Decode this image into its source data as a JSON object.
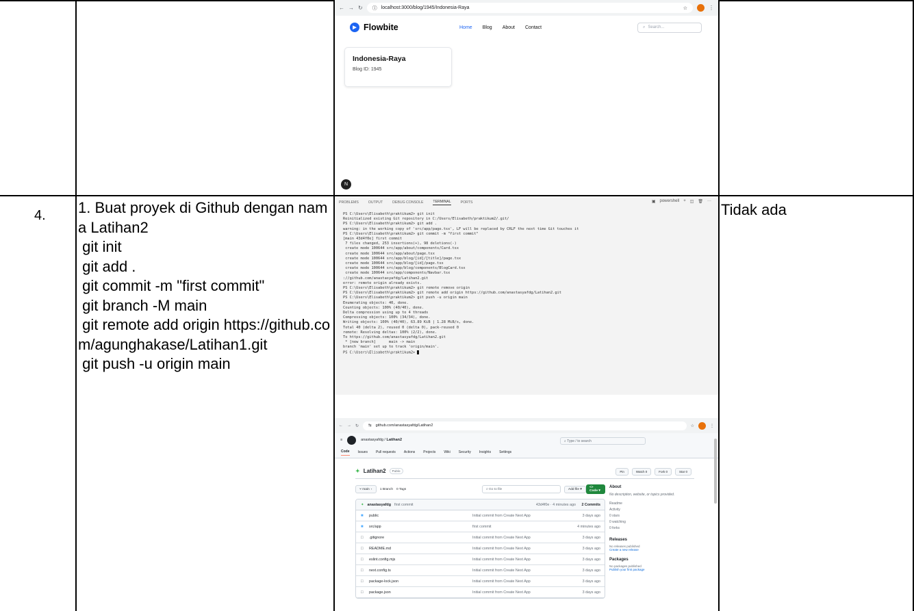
{
  "row": {
    "number": "4.",
    "steps": "1. Buat proyek di Github dengan nama Latihan2\n git init\n git add .\n git commit -m \"first commit\"\n git branch -M main\n git remote add origin https://github.com/agunghakase/Latihan1.git\n git push -u origin main",
    "keterangan": "Tidak ada"
  },
  "browser1": {
    "url": "localhost:3000/blog/1945/Indonesia-Raya",
    "brand": "Flowbite",
    "nav": [
      "Home",
      "Blog",
      "About",
      "Contact"
    ],
    "search_placeholder": "Search...",
    "card_title": "Indonesia-Raya",
    "card_subtitle": "Blog ID: 1945",
    "badge": "N"
  },
  "terminal": {
    "tabs": [
      "PROBLEMS",
      "OUTPUT",
      "DEBUG CONSOLE",
      "TERMINAL",
      "PORTS"
    ],
    "active_tab": "TERMINAL",
    "shell": "powershell",
    "lines": [
      "PS C:\\Users\\Elisabeth\\praktikum2> git init",
      "Reinitialized existing Git repository in C:/Users/Elisabeth/praktikum2/.git/",
      "PS C:\\Users\\Elisabeth\\praktikum2> git add .",
      "warning: in the working copy of 'src/app/page.tsx', LF will be replaced by CRLF the next time Git touches it",
      "PS C:\\Users\\Elisabeth\\praktikum2> git commit -m \"first commit\"",
      "[main 43d4f0e] first commit",
      " 7 files changed, 253 insertions(+), 98 deletions(-)",
      " create mode 100644 src/app/about/components/Card.tsx",
      " create mode 100644 src/app/about/page.tsx",
      " create mode 100644 src/app/blog/[id]/[title]/page.tsx",
      " create mode 100644 src/app/blog/[id]/page.tsx",
      " create mode 100644 src/app/blog/components/BlogCard.tsx",
      " create mode 100644 src/app/components/Navbar.tsx",
      "://github.com/anastasyafdg/Latihan2.git",
      "error: remote origin already exists.",
      "PS C:\\Users\\Elisabeth\\praktikum2> git remote remove origin",
      "PS C:\\Users\\Elisabeth\\praktikum2> git remote add origin https://github.com/anastasyafdg/Latihan2.git",
      "PS C:\\Users\\Elisabeth\\praktikum2> git push -u origin main",
      "Enumerating objects: 40, done.",
      "Counting objects: 100% (40/40), done.",
      "Delta compression using up to 4 threads",
      "Compressing objects: 100% (34/34), done.",
      "Writing objects: 100% (40/40), 63.89 KiB | 1.28 MiB/s, done.",
      "Total 40 (delta 2), reused 0 (delta 0), pack-reused 0",
      "remote: Resolving deltas: 100% (2/2), done.",
      "To https://github.com/anastasyafdg/Latihan2.git",
      " * [new branch]      main -> main",
      "branch 'main' set up to track 'origin/main'.",
      "PS C:\\Users\\Elisabeth\\praktikum2> "
    ]
  },
  "github": {
    "url": "github.com/anastasyafdg/Latihan2",
    "owner": "anastasyafdg",
    "repo": "Latihan2",
    "search": "Type / to search",
    "tabs": [
      "Code",
      "Issues",
      "Pull requests",
      "Actions",
      "Projects",
      "Wiki",
      "Security",
      "Insights",
      "Settings"
    ],
    "visibility": "Public",
    "actions": [
      "Pin",
      "Watch 0",
      "Fork 0",
      "Star 0"
    ],
    "branch": "main",
    "branches": "1 Branch",
    "tags": "0 Tags",
    "goto": "Go to file",
    "add_file": "Add file",
    "code_btn": "Code",
    "commit_author": "anastasyafdg",
    "commit_msg": "first commit",
    "commit_hash": "43d4f0e · 4 minutes ago",
    "commit_count": "2 Commits",
    "files": [
      {
        "name": "public",
        "type": "dir",
        "msg": "Initial commit from Create Next App",
        "when": "3 days ago"
      },
      {
        "name": "src/app",
        "type": "dir",
        "msg": "first commit",
        "when": "4 minutes ago"
      },
      {
        "name": ".gitignore",
        "type": "file",
        "msg": "Initial commit from Create Next App",
        "when": "3 days ago"
      },
      {
        "name": "README.md",
        "type": "file",
        "msg": "Initial commit from Create Next App",
        "when": "3 days ago"
      },
      {
        "name": "eslint.config.mjs",
        "type": "file",
        "msg": "Initial commit from Create Next App",
        "when": "3 days ago"
      },
      {
        "name": "next.config.ts",
        "type": "file",
        "msg": "Initial commit from Create Next App",
        "when": "3 days ago"
      },
      {
        "name": "package-lock.json",
        "type": "file",
        "msg": "Initial commit from Create Next App",
        "when": "3 days ago"
      },
      {
        "name": "package.json",
        "type": "file",
        "msg": "Initial commit from Create Next App",
        "when": "3 days ago"
      }
    ],
    "about_title": "About",
    "about_desc": "No description, website, or topics provided.",
    "about_items": [
      "Readme",
      "Activity",
      "0 stars",
      "0 watching",
      "0 forks"
    ],
    "releases_title": "Releases",
    "releases_text": "No releases published",
    "releases_link": "Create a new release",
    "packages_title": "Packages",
    "packages_text": "No packages published",
    "packages_link": "Publish your first package"
  }
}
